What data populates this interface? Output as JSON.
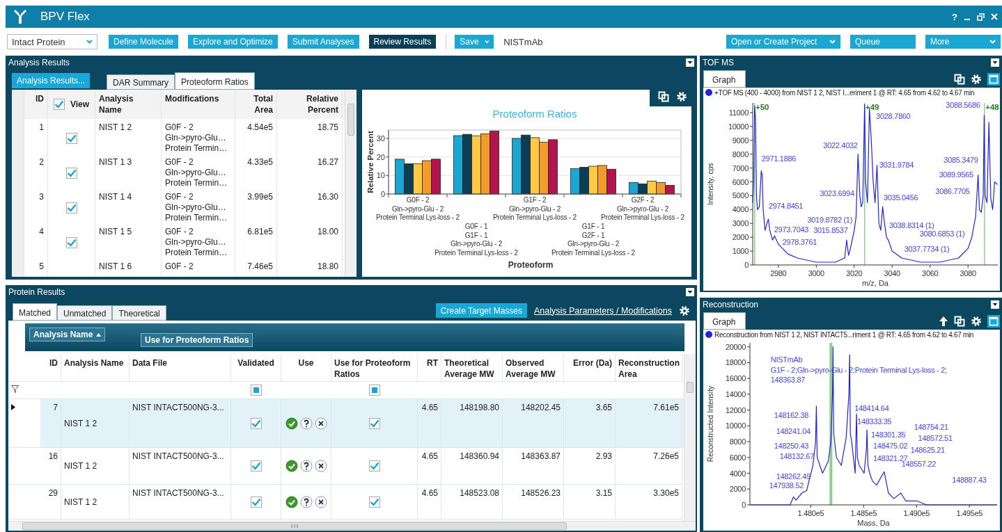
{
  "window": {
    "title": "BPV Flex",
    "help": "?"
  },
  "toolbar": {
    "workflow": "Intact Protein",
    "steps": [
      {
        "label": "Define Molecule",
        "selected": false
      },
      {
        "label": "Explore and Optimize",
        "selected": false
      },
      {
        "label": "Submit Analyses",
        "selected": false
      },
      {
        "label": "Review Results",
        "selected": true
      }
    ],
    "save": "Save",
    "project_name": "NISTmAb",
    "right_buttons": [
      {
        "label": "Open or Create Project",
        "dropdown": true
      },
      {
        "label": "Queue",
        "dropdown": false
      },
      {
        "label": "More",
        "dropdown": true
      }
    ]
  },
  "analysis_results": {
    "title": "Analysis Results",
    "results_button": "Analysis Results...",
    "tabs": [
      {
        "label": "DAR Summary",
        "selected": false
      },
      {
        "label": "Proteoform Ratios",
        "selected": true
      }
    ],
    "table": {
      "columns": [
        "ID",
        "View",
        "Analysis Name",
        "Modifications",
        "Total Area",
        "Relative Percent"
      ],
      "view_all": true,
      "rows": [
        {
          "id": "1",
          "view": true,
          "analysis_name": "NIST 1 2",
          "modifications": [
            "G0F - 2",
            "Gln->pyro-Glu…",
            "Protein Termin…"
          ],
          "total_area": "4.54e5",
          "relative_percent": "18.75"
        },
        {
          "id": "2",
          "view": true,
          "analysis_name": "NIST 1 3",
          "modifications": [
            "G0F - 2",
            "Gln->pyro-Glu…",
            "Protein Termin…"
          ],
          "total_area": "4.33e5",
          "relative_percent": "16.27"
        },
        {
          "id": "3",
          "view": true,
          "analysis_name": "NIST 1 4",
          "modifications": [
            "G0F - 2",
            "Gln->pyro-Glu…",
            "Protein Termin…"
          ],
          "total_area": "3.99e5",
          "relative_percent": "16.30"
        },
        {
          "id": "4",
          "view": true,
          "analysis_name": "NIST 1 5",
          "modifications": [
            "G0F - 2",
            "Gln->pyro-Glu…",
            "Protein Termin…"
          ],
          "total_area": "6.81e5",
          "relative_percent": "18.00"
        },
        {
          "id": "5",
          "analysis_name": "NIST 1 6",
          "modifications": [
            "G0F - 2"
          ],
          "total_area": "7.46e5",
          "relative_percent": "18.80"
        }
      ]
    },
    "chart_data": {
      "type": "bar",
      "title": "Proteoform Ratios",
      "xlabel": "Proteoform",
      "ylabel": "Relative Percent",
      "grid": true,
      "categories": [
        "G0F - 2\nGln->pyro-Glu - 2\nProtein Terminal Lys-loss - 2",
        "G0F - 1\nG1F - 1\nGln->pyro-Glu - 2\nProtein Terminal Lys-loss - 2",
        "G1F - 2\nGln->pyro-Glu - 2\nProtein Terminal Lys-loss - 2",
        "G1F - 1\nG2F - 1\nGln->pyro-Glu - 2\nProtein Terminal Lys-loss - 2",
        "G2F - 2\nGln->pyro-Glu - 2\nProtein Terminal Lys-loss - 2"
      ],
      "series": [
        {
          "color": "#1ba6d4",
          "values": [
            18.8,
            31.5,
            30.0,
            13.7,
            6.2
          ]
        },
        {
          "color": "#0b3d56",
          "values": [
            16.3,
            32.2,
            31.8,
            14.4,
            5.5
          ]
        },
        {
          "color": "#ffc845",
          "values": [
            16.3,
            31.4,
            30.4,
            15.0,
            6.9
          ]
        },
        {
          "color": "#f39c2b",
          "values": [
            18.0,
            32.5,
            28.0,
            15.4,
            6.2
          ]
        },
        {
          "color": "#b3134f",
          "values": [
            18.8,
            34.0,
            29.3,
            13.4,
            4.7
          ]
        }
      ],
      "ylim": [
        0,
        34.5
      ],
      "yticks": [
        0,
        10,
        20,
        30
      ]
    }
  },
  "protein_results": {
    "title": "Protein Results",
    "tabs": [
      {
        "label": "Matched",
        "selected": true
      },
      {
        "label": "Unmatched",
        "selected": false
      },
      {
        "label": "Theoretical",
        "selected": false
      }
    ],
    "create_button": "Create Target Masses",
    "parameters_link": "Analysis Parameters / Modifications",
    "group_by": [
      {
        "label": "Analysis Name",
        "sorted": true
      },
      {
        "label": "Use for Proteoform Ratios",
        "sorted": false
      }
    ],
    "table": {
      "columns": [
        "ID",
        "Analysis Name",
        "Data File",
        "Validated",
        "Use",
        "Use for Proteoform Ratios",
        "RT",
        "Theoretical Average MW",
        "Observed Average MW",
        "Error (Da)",
        "Reconstruction Area"
      ],
      "filter_row": {
        "validated_partial": true,
        "use_for_ratios_partial": true
      },
      "rows": [
        {
          "id": "7",
          "analysis_name": "NIST 1 2",
          "data_file": "NIST INTACT500NG-3...",
          "validated": true,
          "use": {
            "accepted": true,
            "questioned": false,
            "rejected": false
          },
          "use_for_ratios": true,
          "rt": "4.65",
          "theoretical_mw": "148198.80",
          "observed_mw": "148202.45",
          "error": "3.65",
          "reconstruction_area": "7.61e5",
          "selected": true
        },
        {
          "id": "16",
          "analysis_name": "NIST 1 2",
          "data_file": "NIST INTACT500NG-3...",
          "validated": true,
          "use": {
            "accepted": true,
            "questioned": false,
            "rejected": false
          },
          "use_for_ratios": true,
          "rt": "4.65",
          "theoretical_mw": "148360.94",
          "observed_mw": "148363.87",
          "error": "2.93",
          "reconstruction_area": "7.26e5",
          "selected": false
        },
        {
          "id": "29",
          "analysis_name": "NIST 1 2",
          "data_file": "NIST INTACT500NG-3...",
          "validated": true,
          "use": {
            "accepted": true,
            "questioned": false,
            "rejected": false
          },
          "use_for_ratios": true,
          "rt": "4.65",
          "theoretical_mw": "148523.08",
          "observed_mw": "148526.23",
          "error": "3.15",
          "reconstruction_area": "3.30e5",
          "selected": false
        }
      ]
    }
  },
  "tof_ms": {
    "title": "TOF MS",
    "tabs": [
      {
        "label": "Graph",
        "selected": true
      }
    ],
    "chart_data": {
      "type": "line",
      "xlabel": "m/z, Da",
      "ylabel": "Intensity, cps",
      "x": [
        2966.5,
        2967,
        2967.5,
        2968,
        2968.5,
        2969,
        2970,
        2971,
        2971.5,
        2972,
        2973,
        2974,
        2974.8,
        2975.5,
        2977,
        2978,
        2980,
        2985,
        2990,
        3000,
        3010,
        3015,
        3016,
        3017,
        3018,
        3020,
        3021,
        3022,
        3023,
        3023.7,
        3024.5,
        3025.5,
        3026,
        3027,
        3028,
        3029,
        3030,
        3031,
        3032,
        3033,
        3034,
        3035,
        3036,
        3037,
        3038,
        3040,
        3045,
        3055,
        3065,
        3075,
        3080,
        3082,
        3084,
        3085.3,
        3086,
        3087,
        3088,
        3088.5,
        3089,
        3090,
        3091,
        3092,
        3093,
        3094,
        3095.5
      ],
      "series": [
        {
          "name": "+TOF MS (400 - 4000) from NIST 1 2, NIST I...eriment 1 @ RT: 4.65 from 4.62 to 4.67 min",
          "color": "#2222dd",
          "values": [
            4500,
            6000,
            11500,
            10500,
            5000,
            4000,
            4200,
            6800,
            6500,
            4000,
            2500,
            3000,
            3300,
            2500,
            1800,
            2100,
            1500,
            800,
            500,
            200,
            200,
            500,
            1800,
            700,
            1200,
            2500,
            3500,
            8000,
            5000,
            4200,
            4500,
            11600,
            6000,
            4500,
            11300,
            9000,
            6000,
            4500,
            7200,
            3000,
            2500,
            4200,
            3000,
            2000,
            1800,
            1000,
            500,
            200,
            200,
            500,
            1200,
            2000,
            3500,
            6500,
            4000,
            3800,
            5000,
            10800,
            5000,
            4500,
            10300,
            4800,
            4000,
            6000,
            5800
          ]
        }
      ],
      "xlim": [
        2966.5,
        3095.7
      ],
      "ylim": [
        0,
        11700
      ],
      "xticks": [
        2980,
        3000,
        3020,
        3040,
        3060,
        3080
      ],
      "yticks": [
        0,
        1000,
        2000,
        3000,
        4000,
        5000,
        6000,
        7000,
        8000,
        9000,
        10000,
        11000
      ],
      "ref_lines": [
        {
          "axis": "x",
          "value": 2967.5
        },
        {
          "axis": "x",
          "value": 3025.5
        },
        {
          "axis": "x",
          "value": 3088.7
        }
      ],
      "annotations": [
        "+50",
        "+49",
        "+48",
        "3088.5686",
        "3028.7860",
        "3022.4032",
        "2971.1886",
        "3031.9784",
        "3085.3479",
        "3089.9565",
        "3023.6994",
        "3035.0456",
        "3086.7705",
        "2974.8451",
        "3019.8782 (1)",
        "3038.8314 (1)",
        "2973.7043",
        "3015.8537",
        "3080.6853 (1)",
        "2978.3761",
        "3037.7734 (1)"
      ]
    }
  },
  "reconstruction": {
    "title": "Reconstruction",
    "tabs": [
      {
        "label": "Graph",
        "selected": true
      }
    ],
    "chart_data": {
      "type": "line",
      "xlabel": "Mass, Da",
      "ylabel": "Reconstructed Intensity",
      "x": [
        147424,
        147804,
        147836,
        147860,
        147915,
        147960,
        148020,
        148045,
        148052,
        148060,
        148111,
        148164,
        148190,
        148205,
        148210,
        148216,
        148242,
        148288,
        148334,
        148360,
        148367,
        148374,
        148386,
        148419,
        148426,
        148432,
        148440,
        148458,
        148504,
        148525,
        148531,
        148540,
        148557,
        148583,
        148622,
        148694,
        148734,
        148786,
        148852,
        148897,
        149002,
        149094,
        149762
      ],
      "series": [
        {
          "name": "Reconstruction from NIST 1 2, NIST INTACT5...riment 1 @ RT: 4.65 from 4.62 to 4.67 min",
          "color": "#2222dd",
          "values": [
            0,
            0,
            1000,
            600,
            1500,
            1800,
            5000,
            8000,
            12500,
            6000,
            4000,
            5500,
            8000,
            14000,
            20000,
            9000,
            6000,
            5000,
            8500,
            14000,
            19000,
            9000,
            8000,
            4000,
            8000,
            11500,
            6000,
            5000,
            4000,
            7000,
            9500,
            5000,
            4000,
            3000,
            2500,
            4200,
            1500,
            800,
            1500,
            500,
            500,
            0,
            0
          ]
        }
      ],
      "xlim": [
        147424,
        149762
      ],
      "ylim": [
        0,
        20500
      ],
      "xticks": [
        {
          "value": 148000,
          "label": "1.480e5"
        },
        {
          "value": 148500,
          "label": "1.485e5"
        },
        {
          "value": 149000,
          "label": "1.490e5"
        },
        {
          "value": 149500,
          "label": "1.495e5"
        }
      ],
      "yticks": [
        0,
        2000,
        4000,
        6000,
        8000,
        10000,
        12000,
        14000,
        16000,
        18000,
        20000
      ],
      "ref_lines": [
        {
          "axis": "x",
          "value": 148190
        }
      ],
      "annotations": [
        "NISTmAb",
        "G1F - 2;Gln->pyro-Glu - 2;Protein Terminal Lys-loss - 2;",
        "148363.87",
        "148162.38",
        "148241.04",
        "148250.43",
        "148132.67",
        "148262.49",
        "147938.52",
        "148414.64",
        "148333.35",
        "148301.35",
        "148475.02",
        "148321.27",
        "148754.21",
        "148572.51",
        "148625.21",
        "148557.22",
        "148887.43"
      ]
    }
  }
}
